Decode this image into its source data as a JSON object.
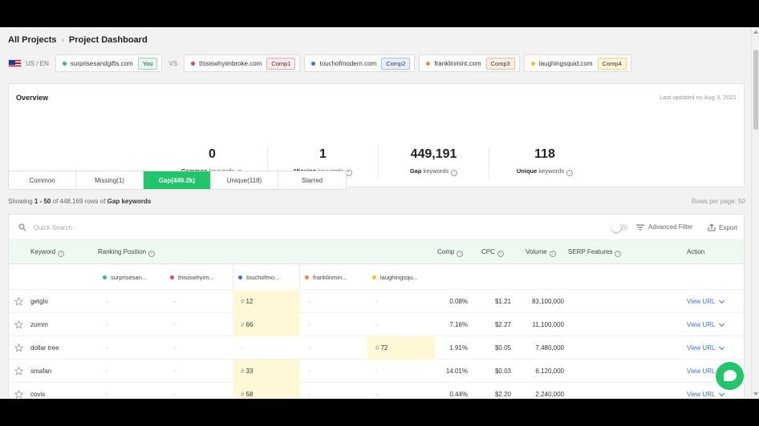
{
  "breadcrumb": {
    "root": "All Projects",
    "current": "Project Dashboard"
  },
  "region": "US / EN",
  "vs_label": "VS",
  "domains": [
    {
      "name": "surprisesandgifts.com",
      "tag": "You",
      "color": "#21c56b",
      "tag_bg": "#e6f8ee",
      "tag_border": "#8fdcb2"
    },
    {
      "name": "thisiswhyimbroke.com",
      "tag": "Comp1",
      "color": "#e0475a",
      "tag_bg": "#fdeaec",
      "tag_border": "#f1a8b0"
    },
    {
      "name": "touchofmodern.com",
      "tag": "Comp2",
      "color": "#3b6fd8",
      "tag_bg": "#e8eefb",
      "tag_border": "#a8bfee"
    },
    {
      "name": "franklinmint.com",
      "tag": "Comp3",
      "color": "#f0883a",
      "tag_bg": "#fdeee3",
      "tag_border": "#f4b98d"
    },
    {
      "name": "laughingsquid.com",
      "tag": "Comp4",
      "color": "#f2c21b",
      "tag_bg": "#fdf6d9",
      "tag_border": "#eed57b"
    }
  ],
  "overview": {
    "title": "Overview",
    "updated": "Last updated on Aug 3, 2021",
    "stats": [
      {
        "value": "0",
        "bold": "Common",
        "rest": "keywords"
      },
      {
        "value": "1",
        "bold": "Missing",
        "rest": "keywords"
      },
      {
        "value": "449,191",
        "bold": "Gap",
        "rest": "keywords"
      },
      {
        "value": "118",
        "bold": "Unique",
        "rest": "keywords"
      }
    ]
  },
  "tabs": [
    "Common",
    "Missing(1)",
    "Gap(449.2k)",
    "Unique(118)",
    "Starred"
  ],
  "showing": {
    "prefix": "Showing ",
    "range": "1 - 50",
    "middle": " of 448,169 rows of ",
    "type": "Gap keywords"
  },
  "rows_per_page": "Rows per page: 50",
  "search": {
    "placeholder": "Quick Search"
  },
  "advanced_filter": "Advanced Filter",
  "export": "Export",
  "columns": {
    "keyword": "Keyword",
    "ranking": "Ranking Position",
    "comp": "Comp",
    "cpc": "CPC",
    "volume": "Volume",
    "serp": "SERP Features",
    "action": "Action"
  },
  "domain_cols": [
    "surprisesan...",
    "thisiswhyim...",
    "touchofmo...",
    "franklinmin...",
    "laughingsqu..."
  ],
  "rows": [
    {
      "keyword": "getglo",
      "ranks": [
        "-",
        "-",
        "12",
        "-",
        "-"
      ],
      "comp": "0.08%",
      "cpc": "$1.21",
      "volume": "83,100,000",
      "action": "View URL"
    },
    {
      "keyword": "zomm",
      "ranks": [
        "-",
        "-",
        "66",
        "-",
        "-"
      ],
      "comp": "7.16%",
      "cpc": "$2.27",
      "volume": "11,100,000",
      "action": "View URL"
    },
    {
      "keyword": "dollar tree",
      "ranks": [
        "-",
        "-",
        "-",
        "-",
        "72"
      ],
      "comp": "1.91%",
      "cpc": "$0.05",
      "volume": "7,480,000",
      "action": "View URL"
    },
    {
      "keyword": "smafan",
      "ranks": [
        "-",
        "-",
        "33",
        "-",
        "-"
      ],
      "comp": "14.01%",
      "cpc": "$0.03",
      "volume": "6,120,000",
      "action": "View URL"
    },
    {
      "keyword": "covis",
      "ranks": [
        "-",
        "-",
        "58",
        "-",
        "-"
      ],
      "comp": "0.44%",
      "cpc": "$2.20",
      "volume": "2,240,000",
      "action": "View URL"
    }
  ]
}
